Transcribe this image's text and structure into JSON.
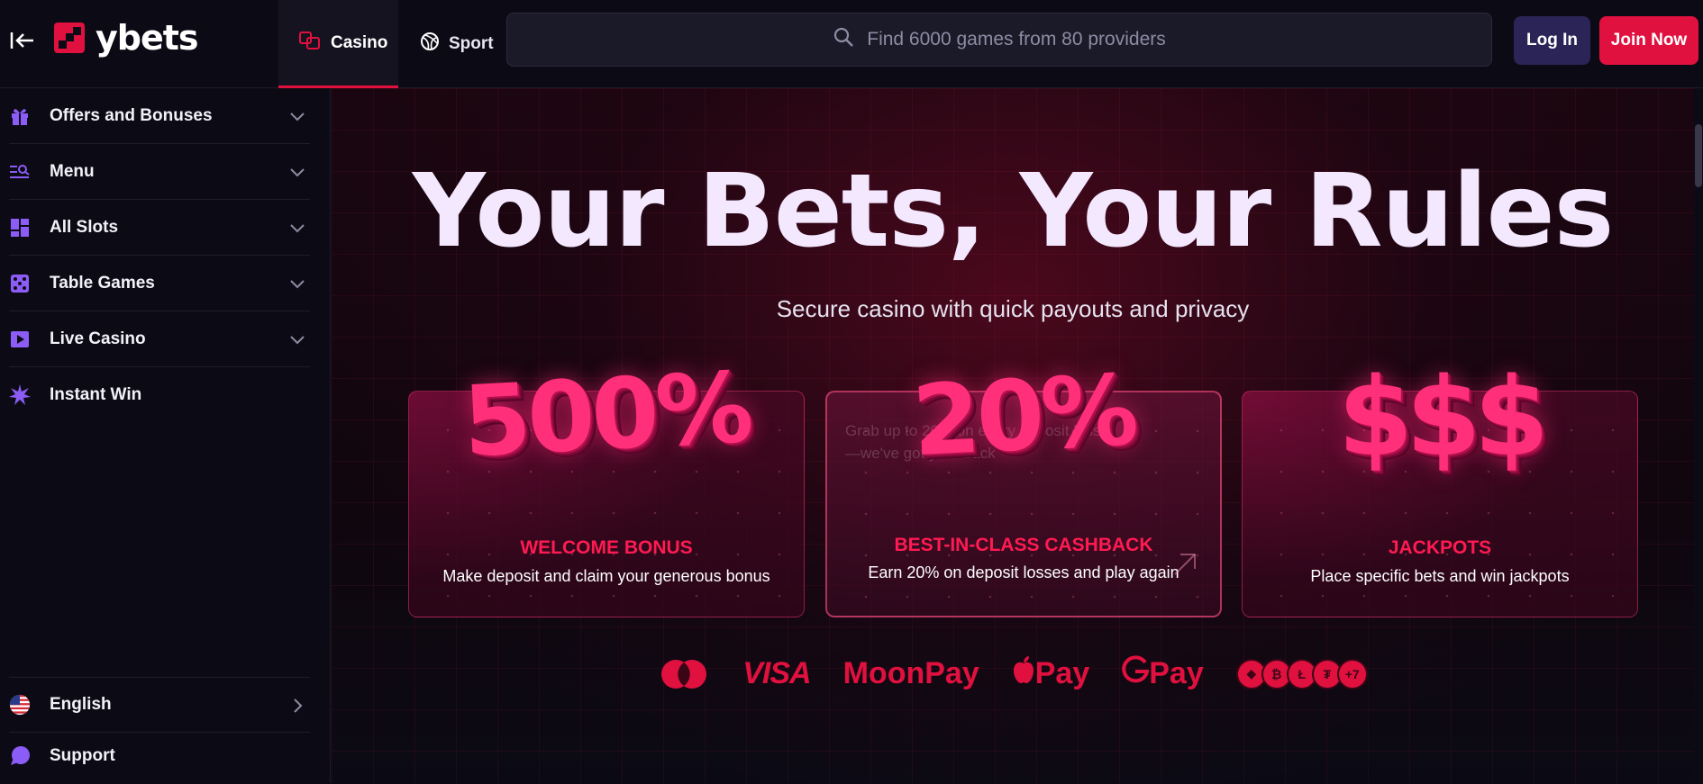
{
  "brand": {
    "name": "ybets",
    "accent": "#e0103f"
  },
  "nav": {
    "tabs": [
      {
        "label": "Casino",
        "icon": "dice-icon",
        "active": true
      },
      {
        "label": "Sport",
        "icon": "ball-icon",
        "active": false
      }
    ]
  },
  "search": {
    "placeholder": "Find 6000 games from 80 providers"
  },
  "auth": {
    "login_label": "Log In",
    "join_label": "Join Now"
  },
  "sidebar": {
    "items": [
      {
        "label": "Offers and Bonuses",
        "icon": "gift-icon",
        "expandable": true
      },
      {
        "label": "Menu",
        "icon": "menu-search-icon",
        "expandable": true
      },
      {
        "label": "All Slots",
        "icon": "slots-grid-icon",
        "expandable": true
      },
      {
        "label": "Table Games",
        "icon": "dice-icon",
        "expandable": true
      },
      {
        "label": "Live Casino",
        "icon": "play-icon",
        "expandable": true
      },
      {
        "label": "Instant Win",
        "icon": "burst-icon",
        "expandable": false
      }
    ],
    "footer": [
      {
        "label": "English",
        "icon": "us-flag-icon"
      },
      {
        "label": "Support",
        "icon": "chat-bubble-icon"
      }
    ]
  },
  "hero": {
    "title": "Your Bets, Your Rules",
    "subtitle": "Secure casino with quick payouts and privacy"
  },
  "cards": [
    {
      "big": "500%",
      "title": "WELCOME BONUS",
      "desc": "Make deposit and claim your generous bonus"
    },
    {
      "big": "20%",
      "title": "BEST-IN-CLASS CASHBACK",
      "desc": "Earn 20% on deposit losses and play again",
      "ghost": "Grab up to 20% on every deposit loss—we've got your back"
    },
    {
      "big": "$$$",
      "title": "JACKPOTS",
      "desc": "Place specific bets and win jackpots"
    }
  ],
  "payments": {
    "visa": "VISA",
    "moonpay": "MoonPay",
    "applepay": "Pay",
    "googlepay": "Pay",
    "crypto_more": "+7"
  }
}
